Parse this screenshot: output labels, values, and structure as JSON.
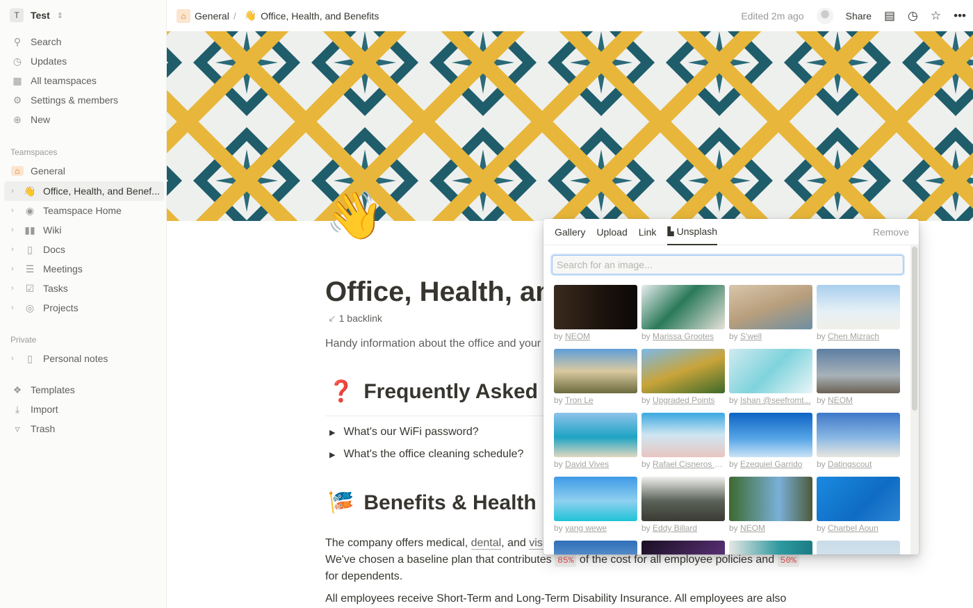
{
  "sidebar": {
    "workspace": {
      "initial": "T",
      "name": "Test"
    },
    "nav": [
      {
        "label": "Search",
        "icon": "search-icon"
      },
      {
        "label": "Updates",
        "icon": "clock-icon"
      },
      {
        "label": "All teamspaces",
        "icon": "building-icon"
      },
      {
        "label": "Settings & members",
        "icon": "gear-icon"
      },
      {
        "label": "New",
        "icon": "plus-circle-icon"
      }
    ],
    "teamspaces_heading": "Teamspaces",
    "general": "General",
    "pages": [
      {
        "label": "Office, Health, and Benef...",
        "icon": "waving-hand-icon"
      },
      {
        "label": "Teamspace Home",
        "icon": "compass-icon"
      },
      {
        "label": "Wiki",
        "icon": "book-icon"
      },
      {
        "label": "Docs",
        "icon": "document-icon"
      },
      {
        "label": "Meetings",
        "icon": "list-icon"
      },
      {
        "label": "Tasks",
        "icon": "checkbox-icon"
      },
      {
        "label": "Projects",
        "icon": "target-icon"
      }
    ],
    "private_heading": "Private",
    "private_pages": [
      {
        "label": "Personal notes",
        "icon": "document-icon"
      }
    ],
    "bottom": [
      {
        "label": "Templates",
        "icon": "templates-icon"
      },
      {
        "label": "Import",
        "icon": "download-icon"
      },
      {
        "label": "Trash",
        "icon": "trash-icon"
      }
    ]
  },
  "topbar": {
    "breadcrumb": [
      "General",
      "Office, Health, and Benefits"
    ],
    "edited": "Edited 2m ago",
    "share": "Share"
  },
  "page": {
    "title": "Office, Health, and Benefits",
    "backlink": "1 backlink",
    "description": "Handy information about the office and your",
    "faq_heading": "Frequently Asked Qu",
    "toggles": [
      "What's our WiFi password?",
      "What's the office cleaning schedule?"
    ],
    "benefits_heading": "Benefits & Health",
    "p1_a": "The company offers medical, ",
    "p1_dental": "dental",
    "p1_b": ", and ",
    "p1_vis": "visi",
    "p2_a": "We've chosen a baseline plan that contributes ",
    "p2_code1": "85%",
    "p2_b": " of the cost for all employee policies and ",
    "p2_code2": "50%",
    "p3": "for dependents.",
    "p4": "All employees receive Short-Term and Long-Term Disability Insurance. All employees are also"
  },
  "popup": {
    "tabs": [
      "Gallery",
      "Upload",
      "Link",
      "Unsplash"
    ],
    "active_tab": "Unsplash",
    "remove": "Remove",
    "search_placeholder": "Search for an image...",
    "by": "by",
    "photos": [
      "NEOM",
      "Marissa Grootes",
      "S'well",
      "Chen Mizrach",
      "Tron Le",
      "Upgraded Points",
      "Ishan @seefromt...",
      "NEOM",
      "David Vives",
      "Rafael Cisneros M...",
      "Ezequiel Garrido",
      "Datingscout",
      "yang wewe",
      "Eddy Billard",
      "NEOM",
      "Charbel Aoun",
      "",
      "",
      "",
      ""
    ]
  }
}
